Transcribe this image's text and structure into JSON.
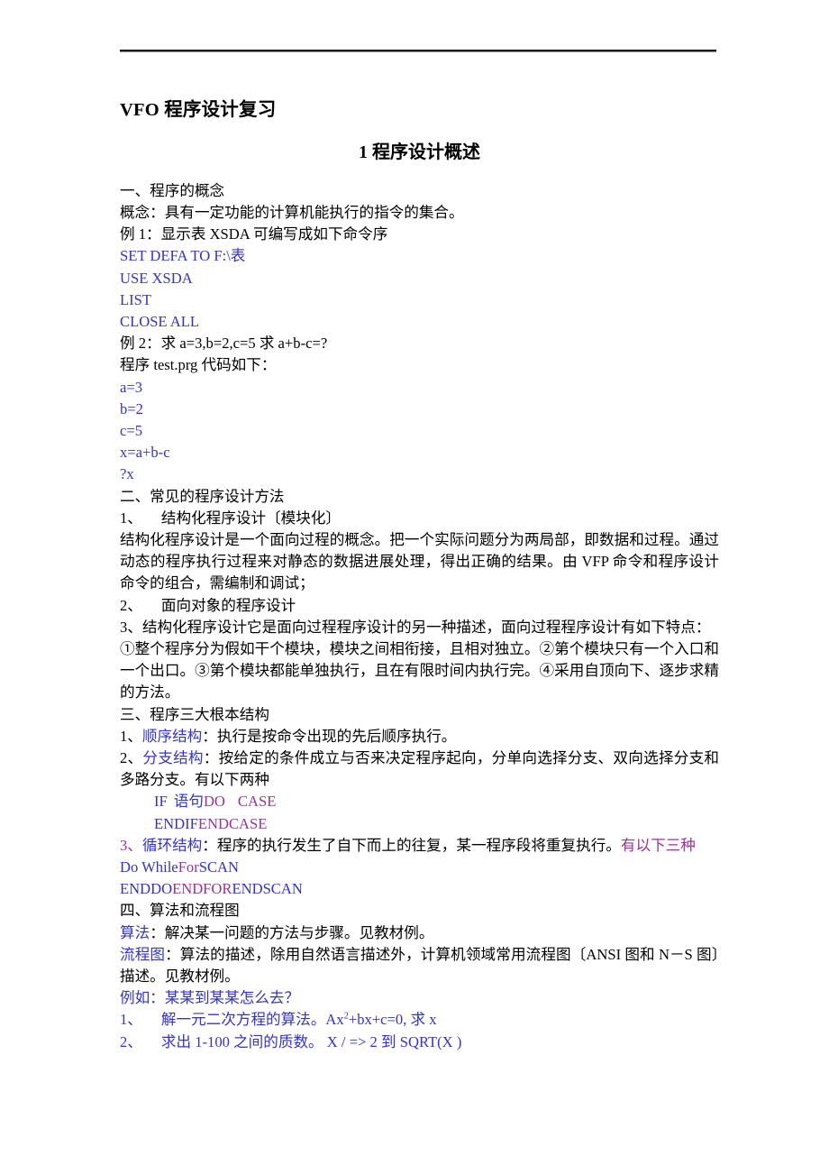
{
  "document": {
    "title": "VFO 程序设计复习",
    "section_heading": "1 程序设计概述",
    "colors": {
      "code_blue": "#3333cc",
      "accent_purple": "#993399",
      "body_black": "#000000"
    },
    "blocks": {
      "h1_concept": "一、程序的概念",
      "concept_def": "概念：具有一定功能的计算机能执行的指令的集合。",
      "example1_intro": "例 1：显示表 XSDA 可编写成如下命令序",
      "example1_code": [
        "SET    DEFA TO F:\\表",
        "USE   XSDA",
        "LIST",
        "CLOSE ALL"
      ],
      "example2_intro": "例 2：求 a=3,b=2,c=5  求 a+b-c=?",
      "example2_file": "程序 test.prg  代码如下：",
      "example2_code": [
        "a=3",
        "b=2",
        "c=5",
        "x=a+b-c",
        "?x"
      ],
      "h2_methods": "二、常见的程序设计方法",
      "method1_label": "1、",
      "method1_text": "结构化程序设计〔模块化〕",
      "method1_body": "结构化程序设计是一个面向过程的概念。把一个实际问题分为两局部，即数据和过程。通过动态的程序执行过程来对静态的数据进展处理，得出正确的结果。由 VFP 命令和程序设计命令的组合，需编制和调试；",
      "method2_label": "2、",
      "method2_text": "面向对象的程序设计",
      "method3_body": "3、结构化程序设计它是面向过程程序设计的另一种描述，面向过程程序设计有如下特点：",
      "method3_points": "①整个程序分为假如干个模块，模块之间相衔接，且相对独立。②第个模块只有一个入口和一个出口。③第个模块都能单独执行，且在有限时间内执行完。④采用自顶向下、逐步求精的方法。",
      "h3_structures": "三、程序三大根本结构",
      "struct1_num": "1、",
      "struct1_name": "顺序结构",
      "struct1_body": "：执行是按命令出现的先后顺序执行。",
      "struct2_num": "2、",
      "struct2_name": "分支结构",
      "struct2_body": "：按给定的条件成立与否来决定程序起向，分单向选择分支、双向选择分支和多路分支。有以下两种",
      "branch_code_if": "IF",
      "branch_code_yuju": "语句",
      "branch_code_do": "DO",
      "branch_code_case": "CASE",
      "branch_code_endif": "ENDIF",
      "branch_code_endcase": "ENDCASE",
      "struct3_num": "3、",
      "struct3_name": "循环结构",
      "struct3_body": "：程序的执行发生了自下而上的往复，某一程序段将重复执行。",
      "struct3_tail": "有以下三种",
      "loop_dowhile": "Do While",
      "loop_for": "For",
      "loop_scan": "SCAN",
      "loop_enddo": "ENDDO",
      "loop_endfor": "ENDFOR",
      "loop_endscan": "ENDSCAN",
      "h4_algorithm": "四、算法和流程图",
      "algo_label": "算法",
      "algo_body": "：解决某一问题的方法与步骤。见教材例。",
      "flow_label": "流程图",
      "flow_body": "：算法的描述，除用自然语言描述外，计算机领域常用流程图〔ANSI 图和 N－S 图〕描述。见教材例。",
      "example_label": "例如：某某到某某怎么去？",
      "q1_num": "1、",
      "q1_pre": "解一元二次方程的算法。Ax",
      "q1_sup": "2",
      "q1_post": "+bx+c=0, 求 x",
      "q2_num": "2、",
      "q2_text": "求出 1-100 之间的质数。  X /   => 2 到  SQRT(X )"
    }
  }
}
